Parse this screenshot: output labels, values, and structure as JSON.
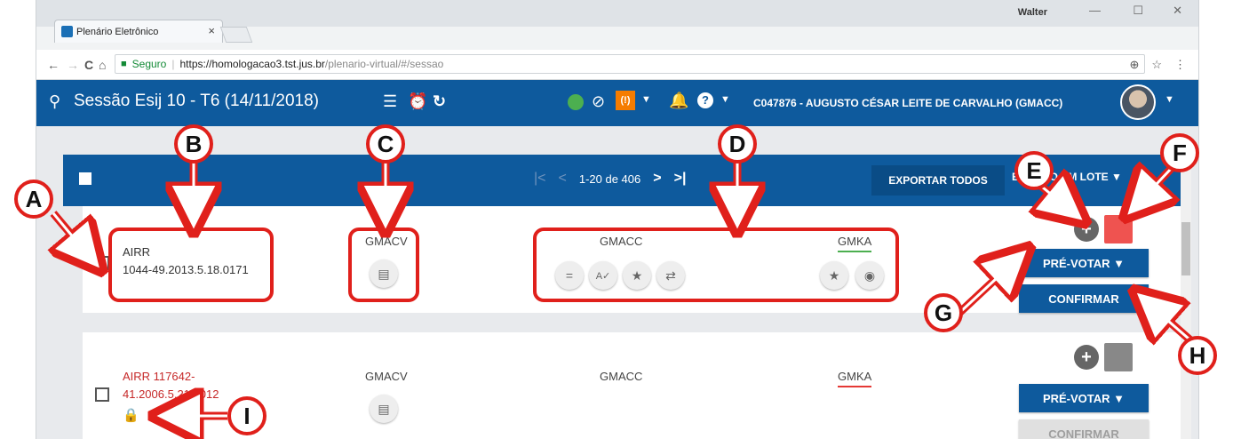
{
  "browser": {
    "tab_title": "Plenário Eletrônico",
    "tab_close": "×",
    "window_user": "Walter",
    "win_min": "—",
    "win_max": "☐",
    "win_close": "✕",
    "back": "←",
    "forward": "→",
    "reload": "C",
    "home": "⌂",
    "secure_label": "Seguro",
    "url_host": "https://homologacao3.tst.jus.br",
    "url_path": "/plenario-virtual/#/sessao",
    "translate_icon": "⊕",
    "star_icon": "☆",
    "menu_icon": "⋮"
  },
  "header": {
    "session_title": "Sessão Esij 10 - T6 (14/11/2018)",
    "list_icon": "☰",
    "alarm_icon": "⏰",
    "refresh_icon": "↻",
    "block_icon": "⊘",
    "orange_label": "(!)",
    "bell_icon": "🔔",
    "help_label": "?",
    "caret": "▼",
    "user": "C047876 - AUGUSTO CÉSAR LEITE DE CARVALHO (GMACC)"
  },
  "toolbar": {
    "first": "|<",
    "prev": "<",
    "range": "1-20 de 406",
    "next": ">",
    "last": ">|",
    "export": "EXPORTAR TODOS",
    "batch": "ERAÇÃO EM LOTE ▼"
  },
  "rows": [
    {
      "proc_type": "AIRR",
      "proc_number": "1044-49.2013.5.18.0171",
      "relator": "GMACV",
      "voter": "GMACC",
      "reviewer": "GMKA",
      "reviewer_line_color": "#4caf50",
      "status_color": "#ef5350",
      "prevote": "PRÉ-VOTAR ▼",
      "confirm": "CONFIRMAR"
    },
    {
      "proc_type": "AIRR 117642-",
      "proc_number": "41.2006.5.21.0012",
      "relator": "GMACV",
      "voter": "GMACC",
      "reviewer": "GMKA",
      "reviewer_line_color": "#e53935",
      "status_color": "#888888",
      "prevote": "PRÉ-VOTAR ▼",
      "confirm": "CONFIRMAR"
    }
  ],
  "icons": {
    "doc": "▤",
    "equal": "=",
    "spell": "A✓",
    "star": "★",
    "swap": "⇄",
    "eye": "◉",
    "plus": "+",
    "lock": "🔒"
  },
  "callouts": [
    "A",
    "B",
    "C",
    "D",
    "E",
    "F",
    "G",
    "H",
    "I"
  ]
}
